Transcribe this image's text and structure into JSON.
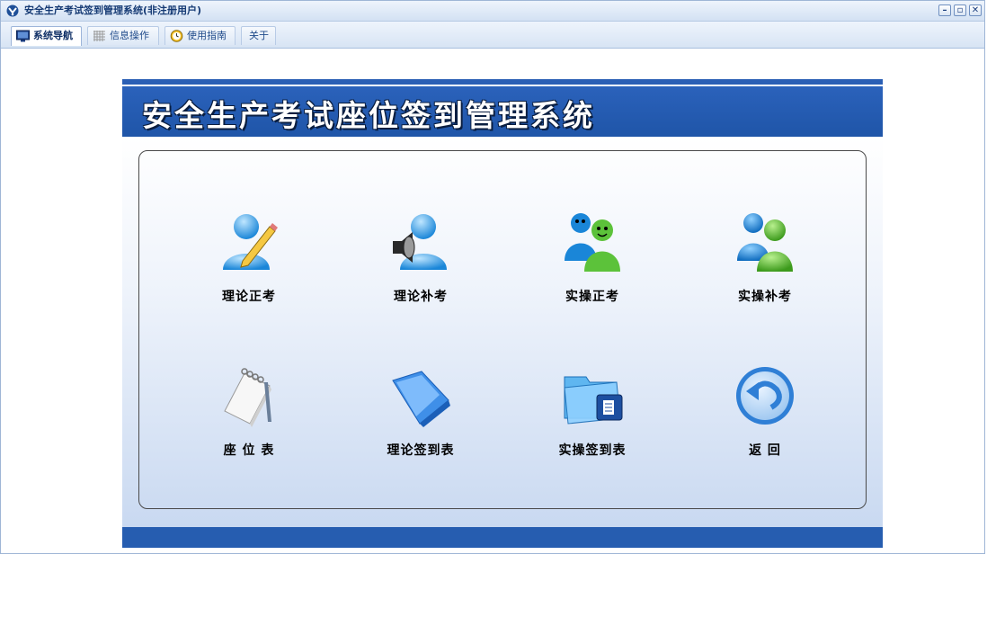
{
  "window": {
    "title": "安全生产考试签到管理系统(非注册用户)",
    "controls": {
      "minimize": "–",
      "restore": "▫",
      "close": "✕"
    }
  },
  "toolbar": {
    "tabs": [
      {
        "label": "系统导航",
        "icon": "monitor-icon",
        "active": true
      },
      {
        "label": "信息操作",
        "icon": "grid-icon",
        "active": false
      },
      {
        "label": "使用指南",
        "icon": "clock-icon",
        "active": false
      },
      {
        "label": "关于",
        "icon": "",
        "active": false
      }
    ]
  },
  "banner": {
    "title": "安全生产考试座位签到管理系统"
  },
  "menu": [
    {
      "label": "理论正考",
      "icon": "user-pencil-icon"
    },
    {
      "label": "理论补考",
      "icon": "user-speaker-icon"
    },
    {
      "label": "实操正考",
      "icon": "users-smile-icon"
    },
    {
      "label": "实操补考",
      "icon": "users-icon"
    },
    {
      "label": "座  位  表",
      "icon": "notepad-icon"
    },
    {
      "label": "理论签到表",
      "icon": "folder-open-icon"
    },
    {
      "label": "实操签到表",
      "icon": "folder-document-icon"
    },
    {
      "label": "返        回",
      "icon": "return-icon"
    }
  ],
  "colors": {
    "banner_blue": "#2b62bb",
    "title_text": "#153a74",
    "footer_blue": "#265db0"
  }
}
